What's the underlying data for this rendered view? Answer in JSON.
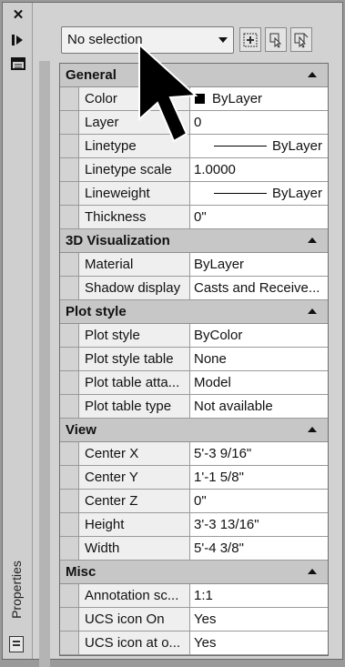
{
  "palette": {
    "title": "Properties"
  },
  "selector": {
    "value": "No selection"
  },
  "sections": {
    "general": {
      "title": "General",
      "rows": [
        {
          "name": "Color",
          "value": "ByLayer"
        },
        {
          "name": "Layer",
          "value": "0"
        },
        {
          "name": "Linetype",
          "value": "ByLayer"
        },
        {
          "name": "Linetype scale",
          "value": "1.0000"
        },
        {
          "name": "Lineweight",
          "value": "ByLayer"
        },
        {
          "name": "Thickness",
          "value": "0\""
        }
      ]
    },
    "vis3d": {
      "title": "3D Visualization",
      "rows": [
        {
          "name": "Material",
          "value": "ByLayer"
        },
        {
          "name": "Shadow display",
          "value": "Casts and Receive..."
        }
      ]
    },
    "plot": {
      "title": "Plot style",
      "rows": [
        {
          "name": "Plot style",
          "value": "ByColor"
        },
        {
          "name": "Plot style table",
          "value": "None"
        },
        {
          "name": "Plot table atta...",
          "value": "Model"
        },
        {
          "name": "Plot table type",
          "value": "Not available"
        }
      ]
    },
    "view": {
      "title": "View",
      "rows": [
        {
          "name": "Center X",
          "value": "5'-3 9/16\""
        },
        {
          "name": "Center Y",
          "value": "1'-1 5/8\""
        },
        {
          "name": "Center Z",
          "value": "0\""
        },
        {
          "name": "Height",
          "value": "3'-3 13/16\""
        },
        {
          "name": "Width",
          "value": "5'-4 3/8\""
        }
      ]
    },
    "misc": {
      "title": "Misc",
      "rows": [
        {
          "name": "Annotation sc...",
          "value": "1:1"
        },
        {
          "name": "UCS icon On",
          "value": "Yes"
        },
        {
          "name": "UCS icon at o...",
          "value": "Yes"
        }
      ]
    }
  },
  "icons": [
    "close-icon",
    "auto-hide-icon",
    "palette-properties-icon",
    "toggle-pickadd-icon",
    "select-objects-icon",
    "quick-select-icon",
    "collapse-section-icon",
    "dropdown-arrow-icon",
    "mouse-pointer-icon"
  ]
}
